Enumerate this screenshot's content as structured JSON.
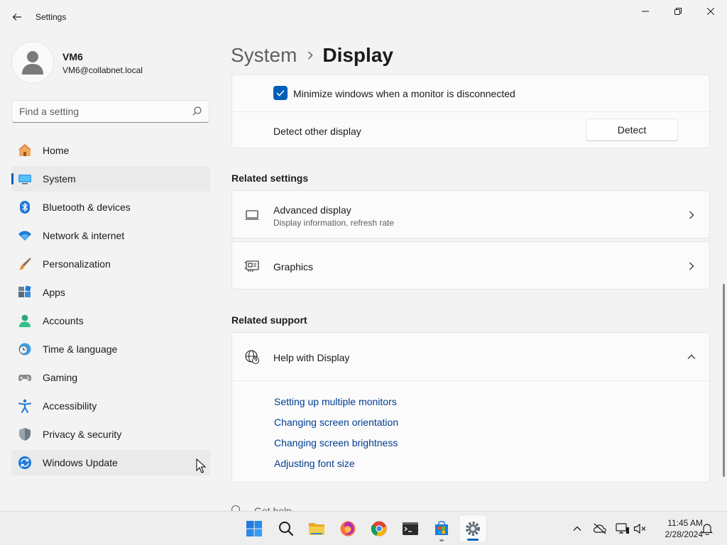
{
  "window": {
    "title": "Settings"
  },
  "profile": {
    "name": "VM6",
    "email": "VM6@collabnet.local"
  },
  "search": {
    "placeholder": "Find a setting"
  },
  "nav": {
    "items": [
      {
        "label": "Home",
        "icon": "home-icon"
      },
      {
        "label": "System",
        "icon": "system-icon"
      },
      {
        "label": "Bluetooth & devices",
        "icon": "bluetooth-icon"
      },
      {
        "label": "Network & internet",
        "icon": "wifi-icon"
      },
      {
        "label": "Personalization",
        "icon": "brush-icon"
      },
      {
        "label": "Apps",
        "icon": "apps-icon"
      },
      {
        "label": "Accounts",
        "icon": "accounts-icon"
      },
      {
        "label": "Time & language",
        "icon": "clock-globe-icon"
      },
      {
        "label": "Gaming",
        "icon": "gamepad-icon"
      },
      {
        "label": "Accessibility",
        "icon": "accessibility-icon"
      },
      {
        "label": "Privacy & security",
        "icon": "shield-icon"
      },
      {
        "label": "Windows Update",
        "icon": "update-icon"
      }
    ],
    "active": "System"
  },
  "breadcrumb": {
    "parent": "System",
    "current": "Display"
  },
  "display": {
    "minimize_label": "Minimize windows when a monitor is disconnected",
    "minimize_checked": true,
    "detect_label": "Detect other display",
    "detect_button": "Detect"
  },
  "related_settings": {
    "title": "Related settings",
    "advanced": {
      "label": "Advanced display",
      "sub": "Display information, refresh rate"
    },
    "graphics": {
      "label": "Graphics"
    }
  },
  "related_support": {
    "title": "Related support",
    "help_label": "Help with Display",
    "links": [
      "Setting up multiple monitors",
      "Changing screen orientation",
      "Changing screen brightness",
      "Adjusting font size"
    ],
    "partial": "Get help"
  },
  "taskbar": {
    "apps": [
      "start-icon",
      "search-icon",
      "file-explorer-icon",
      "firefox-icon",
      "chrome-icon",
      "terminal-icon",
      "store-icon",
      "settings-icon"
    ],
    "time": "11:45 AM",
    "date": "2/28/2024"
  },
  "colors": {
    "accent": "#005fb8",
    "link": "#003e92"
  }
}
